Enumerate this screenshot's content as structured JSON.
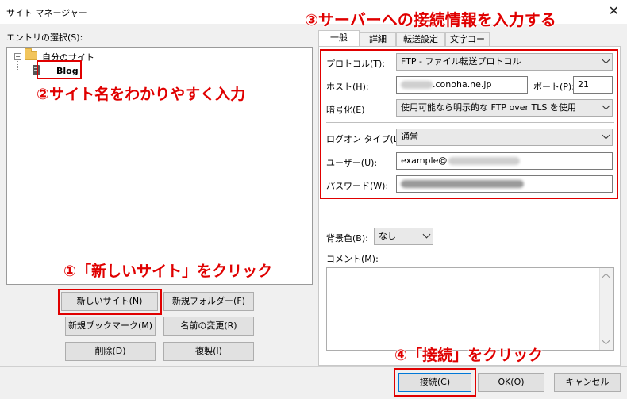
{
  "window": {
    "title": "サイト マネージャー",
    "close_glyph": "✕"
  },
  "left": {
    "section_label": "エントリの選択(S):",
    "tree": {
      "toggle": "−",
      "root_label": "自分のサイト",
      "child_label": "Blog"
    },
    "buttons": {
      "new_site": "新しいサイト(N)",
      "new_folder": "新規フォルダー(F)",
      "new_bookmark": "新規ブックマーク(M)",
      "rename": "名前の変更(R)",
      "delete": "削除(D)",
      "duplicate": "複製(I)"
    }
  },
  "tabs": [
    {
      "label": "一般"
    },
    {
      "label": "詳細"
    },
    {
      "label": "転送設定"
    },
    {
      "label": "文字コード"
    }
  ],
  "general": {
    "protocol_label": "プロトコル(T):",
    "protocol_value": "FTP - ファイル転送プロトコル",
    "host_label": "ホスト(H):",
    "host_value": ".conoha.ne.jp",
    "port_label": "ポート(P):",
    "port_value": "21",
    "encryption_label": "暗号化(E)",
    "encryption_value": "使用可能なら明示的な FTP over TLS を使用",
    "logon_type_label": "ログオン タイプ(L):",
    "logon_type_value": "通常",
    "user_label": "ユーザー(U):",
    "user_value": "example@",
    "password_label": "パスワード(W):",
    "bg_color_label": "背景色(B):",
    "bg_color_value": "なし",
    "comment_label": "コメント(M):"
  },
  "footer": {
    "connect": "接続(C)",
    "ok": "OK(O)",
    "cancel": "キャンセル"
  },
  "annotations": {
    "step1": "①「新しいサイト」をクリック",
    "step2": "②サイト名をわかりやすく入力",
    "step3": "③サーバーへの接続情報を入力する",
    "step4": "④「接続」をクリック"
  },
  "colors": {
    "annotation_red": "#e00000"
  }
}
